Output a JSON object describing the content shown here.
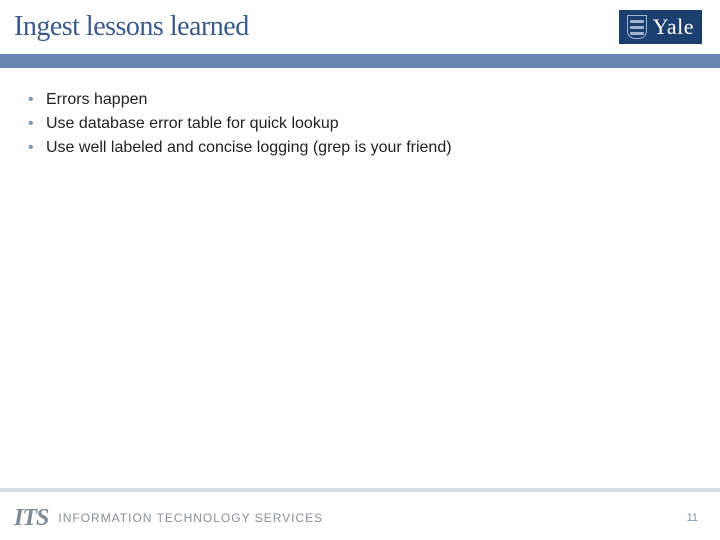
{
  "header": {
    "title": "Ingest lessons learned",
    "brand": "Yale"
  },
  "bullets": [
    "Errors happen",
    "Use database error table for quick lookup",
    "Use well labeled and concise logging (grep is your friend)"
  ],
  "footer": {
    "its_logo": "ITS",
    "its_text": "INFORMATION TECHNOLOGY SERVICES",
    "page_number": "11"
  }
}
